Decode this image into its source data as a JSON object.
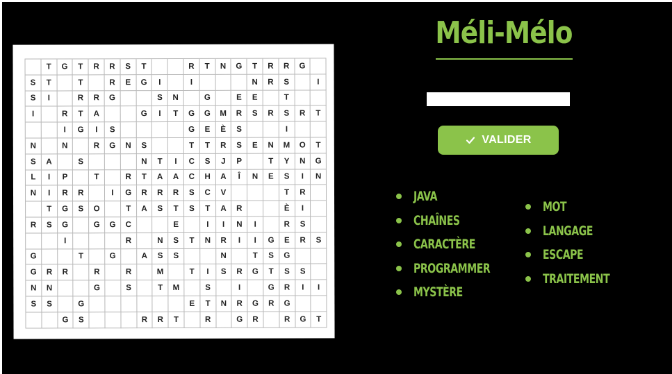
{
  "title": "Méli-Mélo",
  "answer_input": {
    "value": "",
    "placeholder": ""
  },
  "validate_button": {
    "label": "VALIDER",
    "icon": "check-icon"
  },
  "word_list": {
    "column1": [
      "JAVA",
      "CHAÎNES",
      "CARACTÈRE",
      "PROGRAMMER",
      "MYSTÈRE"
    ],
    "column2": [
      "MOT",
      "LANGAGE",
      "ESCAPE",
      "TRAITEMENT"
    ]
  },
  "colors": {
    "accent": "#8bc34a",
    "background": "#000000",
    "board": "#ffffff",
    "grid_line": "#b7b7b7"
  },
  "grid": [
    [
      "",
      "T",
      "G",
      "T",
      "R",
      "R",
      "S",
      "T",
      "",
      "",
      "R",
      "T",
      "N",
      "G",
      "T",
      "R",
      "R",
      "G",
      ""
    ],
    [
      "S",
      "T",
      "",
      "T",
      "",
      "R",
      "E",
      "G",
      "I",
      "",
      "I",
      "",
      "",
      "",
      "N",
      "R",
      "S",
      "",
      "I"
    ],
    [
      "S",
      "I",
      "",
      "R",
      "R",
      "G",
      "",
      "",
      "S",
      "N",
      "",
      "G",
      "",
      "E",
      "E",
      "",
      "T",
      "",
      ""
    ],
    [
      "I",
      "",
      "R",
      "T",
      "A",
      "",
      "",
      "G",
      "I",
      "T",
      "G",
      "G",
      "M",
      "R",
      "S",
      "R",
      "S",
      "R",
      "T"
    ],
    [
      "",
      "",
      "I",
      "G",
      "I",
      "S",
      "",
      "",
      "",
      "",
      "G",
      "E",
      "È",
      "S",
      "",
      "",
      "I",
      "",
      ""
    ],
    [
      "N",
      "",
      "N",
      "",
      "R",
      "G",
      "N",
      "S",
      "",
      "",
      "T",
      "T",
      "R",
      "S",
      "E",
      "N",
      "M",
      "O",
      "T"
    ],
    [
      "S",
      "A",
      "",
      "S",
      "",
      "",
      "",
      "N",
      "T",
      "I",
      "C",
      "S",
      "J",
      "P",
      "",
      "T",
      "Y",
      "N",
      "G"
    ],
    [
      "L",
      "I",
      "P",
      "",
      "T",
      "",
      "R",
      "T",
      "A",
      "A",
      "C",
      "H",
      "A",
      "Î",
      "N",
      "E",
      "S",
      "I",
      "N"
    ],
    [
      "N",
      "I",
      "R",
      "R",
      "",
      "I",
      "G",
      "R",
      "R",
      "R",
      "S",
      "C",
      "V",
      "",
      "",
      "",
      "T",
      "R",
      ""
    ],
    [
      "",
      "T",
      "G",
      "S",
      "O",
      "",
      "T",
      "A",
      "S",
      "T",
      "S",
      "T",
      "A",
      "R",
      "",
      "",
      "È",
      "I",
      ""
    ],
    [
      "R",
      "S",
      "G",
      "",
      "G",
      "G",
      "C",
      "",
      "",
      "E",
      "",
      "I",
      "I",
      "N",
      "I",
      "",
      "R",
      "S",
      ""
    ],
    [
      "",
      "",
      "I",
      "",
      "",
      "",
      "R",
      "",
      "N",
      "S",
      "T",
      "N",
      "R",
      "I",
      "I",
      "G",
      "E",
      "R",
      "S"
    ],
    [
      "G",
      "",
      "",
      "T",
      "",
      "G",
      "",
      "A",
      "S",
      "S",
      "",
      "",
      "N",
      "",
      "T",
      "S",
      "G",
      "",
      ""
    ],
    [
      "G",
      "R",
      "R",
      "",
      "R",
      "",
      "R",
      "",
      "M",
      "",
      "T",
      "I",
      "S",
      "R",
      "G",
      "T",
      "S",
      "S",
      ""
    ],
    [
      "N",
      "N",
      "",
      "",
      "G",
      "",
      "S",
      "",
      "T",
      "M",
      "",
      "S",
      "",
      "I",
      "",
      "G",
      "R",
      "I",
      "I"
    ],
    [
      "S",
      "S",
      "",
      "G",
      "",
      "",
      "",
      "",
      "",
      "",
      "E",
      "T",
      "N",
      "R",
      "G",
      "R",
      "G",
      "",
      ""
    ],
    [
      "",
      "",
      "G",
      "S",
      "",
      "",
      "",
      "R",
      "R",
      "T",
      "",
      "R",
      "",
      "G",
      "R",
      "",
      "R",
      "G",
      "T"
    ]
  ]
}
